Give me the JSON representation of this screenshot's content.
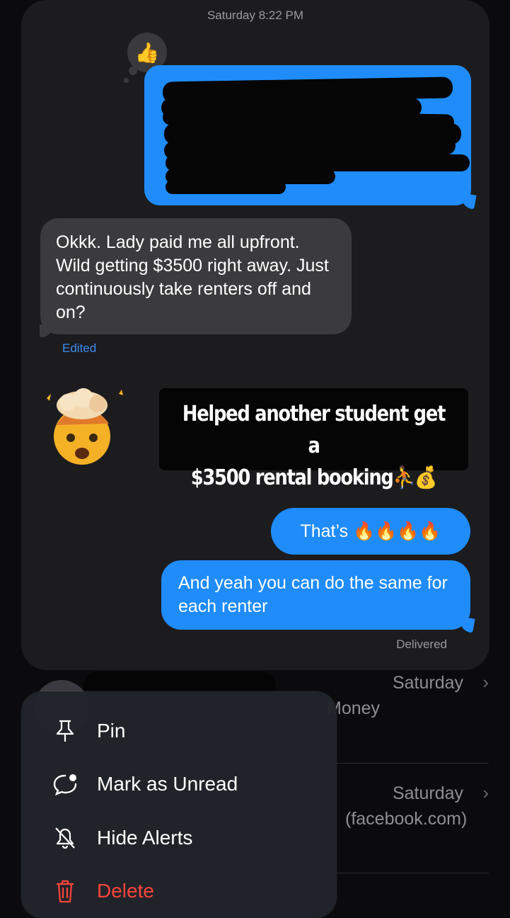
{
  "background_list": {
    "rows": [
      {
        "time": "Saturday",
        "subtitle": "Money"
      },
      {
        "time": "Saturday",
        "subtitle": "(facebook.com)"
      },
      {
        "time": "Saturday",
        "subtitle": ""
      }
    ]
  },
  "conversation": {
    "timestamp": "Saturday 8:22 PM",
    "tapback_emoji": "👍",
    "incoming_message": "Okkk. Lady paid me all upfront. Wild getting $3500 right away. Just continuously take renters off and on?",
    "edited_label": "Edited",
    "mindblown_emoji": "🤯",
    "story_card": {
      "line1": "Helped another student get a",
      "line2": "$3500 rental booking⛹️💰"
    },
    "outgoing_short": "That’s 🔥🔥🔥🔥",
    "outgoing_long": "And yeah you can do the same for each renter",
    "delivered_label": "Delivered"
  },
  "context_menu": {
    "items": [
      {
        "label": "Pin",
        "icon": "pin-icon"
      },
      {
        "label": "Mark as Unread",
        "icon": "unread-icon"
      },
      {
        "label": "Hide Alerts",
        "icon": "bell-slash-icon"
      },
      {
        "label": "Delete",
        "icon": "trash-icon"
      }
    ]
  },
  "colors": {
    "imessage_blue": "#1f8cf9",
    "incoming_gray": "#3b3b3d",
    "destructive_red": "#ff453a",
    "link_blue": "#3b8cf0"
  }
}
